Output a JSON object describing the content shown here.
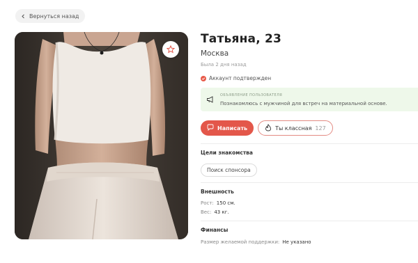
{
  "nav": {
    "back_label": "Вернуться назад"
  },
  "profile": {
    "name": "Татьяна, 23",
    "city": "Москва",
    "last_seen": "Была 2 дня назад",
    "verified_label": "Аккаунт подтвержден"
  },
  "ad": {
    "label": "ОБЪЯВЛЕНИЕ ПОЛЬЗОВАТЕЛЯ",
    "text": "Познакомлюсь с мужчиной для встреч на материальной основе."
  },
  "actions": {
    "write_label": "Написать",
    "like_label": "Ты классная",
    "like_count": "127"
  },
  "goals": {
    "title": "Цели знакомства",
    "tags": [
      "Поиск спонсора"
    ]
  },
  "appearance": {
    "title": "Внешность",
    "height_label": "Рост:",
    "height_value": "150 см.",
    "weight_label": "Вес:",
    "weight_value": "43 кг."
  },
  "finance": {
    "title": "Финансы",
    "support_label": "Размер желаемой поддержки:",
    "support_value": "Не указано"
  },
  "colors": {
    "accent": "#e3574a",
    "ad_bg": "#eef8ea",
    "verified": "#e85b4a"
  },
  "icons": {
    "back": "chevron-left-icon",
    "favorite": "star-icon",
    "verified": "check-circle-icon",
    "ad": "megaphone-icon",
    "write": "chat-bubble-icon",
    "like": "flame-icon"
  }
}
